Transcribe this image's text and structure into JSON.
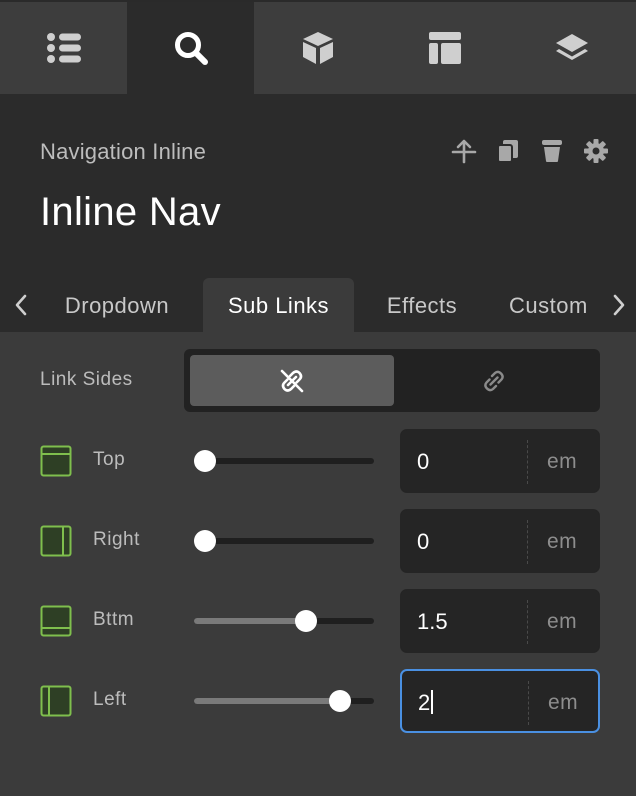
{
  "topbar": {
    "tabs": [
      {
        "icon": "list-icon"
      },
      {
        "icon": "search-icon",
        "active": true
      },
      {
        "icon": "cube-icon"
      },
      {
        "icon": "layout-icon"
      },
      {
        "icon": "layers-icon"
      }
    ]
  },
  "header": {
    "subtitle": "Navigation Inline",
    "title": "Inline Nav",
    "actions": [
      "move-up-icon",
      "duplicate-icon",
      "trash-icon",
      "settings-icon"
    ]
  },
  "subtabs": {
    "items": [
      "Dropdown",
      "Sub Links",
      "Effects",
      "Custom"
    ],
    "active": "Sub Links"
  },
  "link_sides": {
    "label": "Link Sides",
    "options": [
      "linked-icon",
      "unlinked-icon"
    ],
    "selected": "linked-icon"
  },
  "rows": [
    {
      "label": "Top",
      "value": "0",
      "unit": "em",
      "slider": 0.06
    },
    {
      "label": "Right",
      "value": "0",
      "unit": "em",
      "slider": 0.06
    },
    {
      "label": "Bttm",
      "value": "1.5",
      "unit": "em",
      "slider": 0.62
    },
    {
      "label": "Left",
      "value": "2",
      "unit": "em",
      "slider": 0.81,
      "focused": true
    }
  ],
  "colors": {
    "accent_green": "#7fbf4d",
    "focus_blue": "#4a90e2"
  }
}
